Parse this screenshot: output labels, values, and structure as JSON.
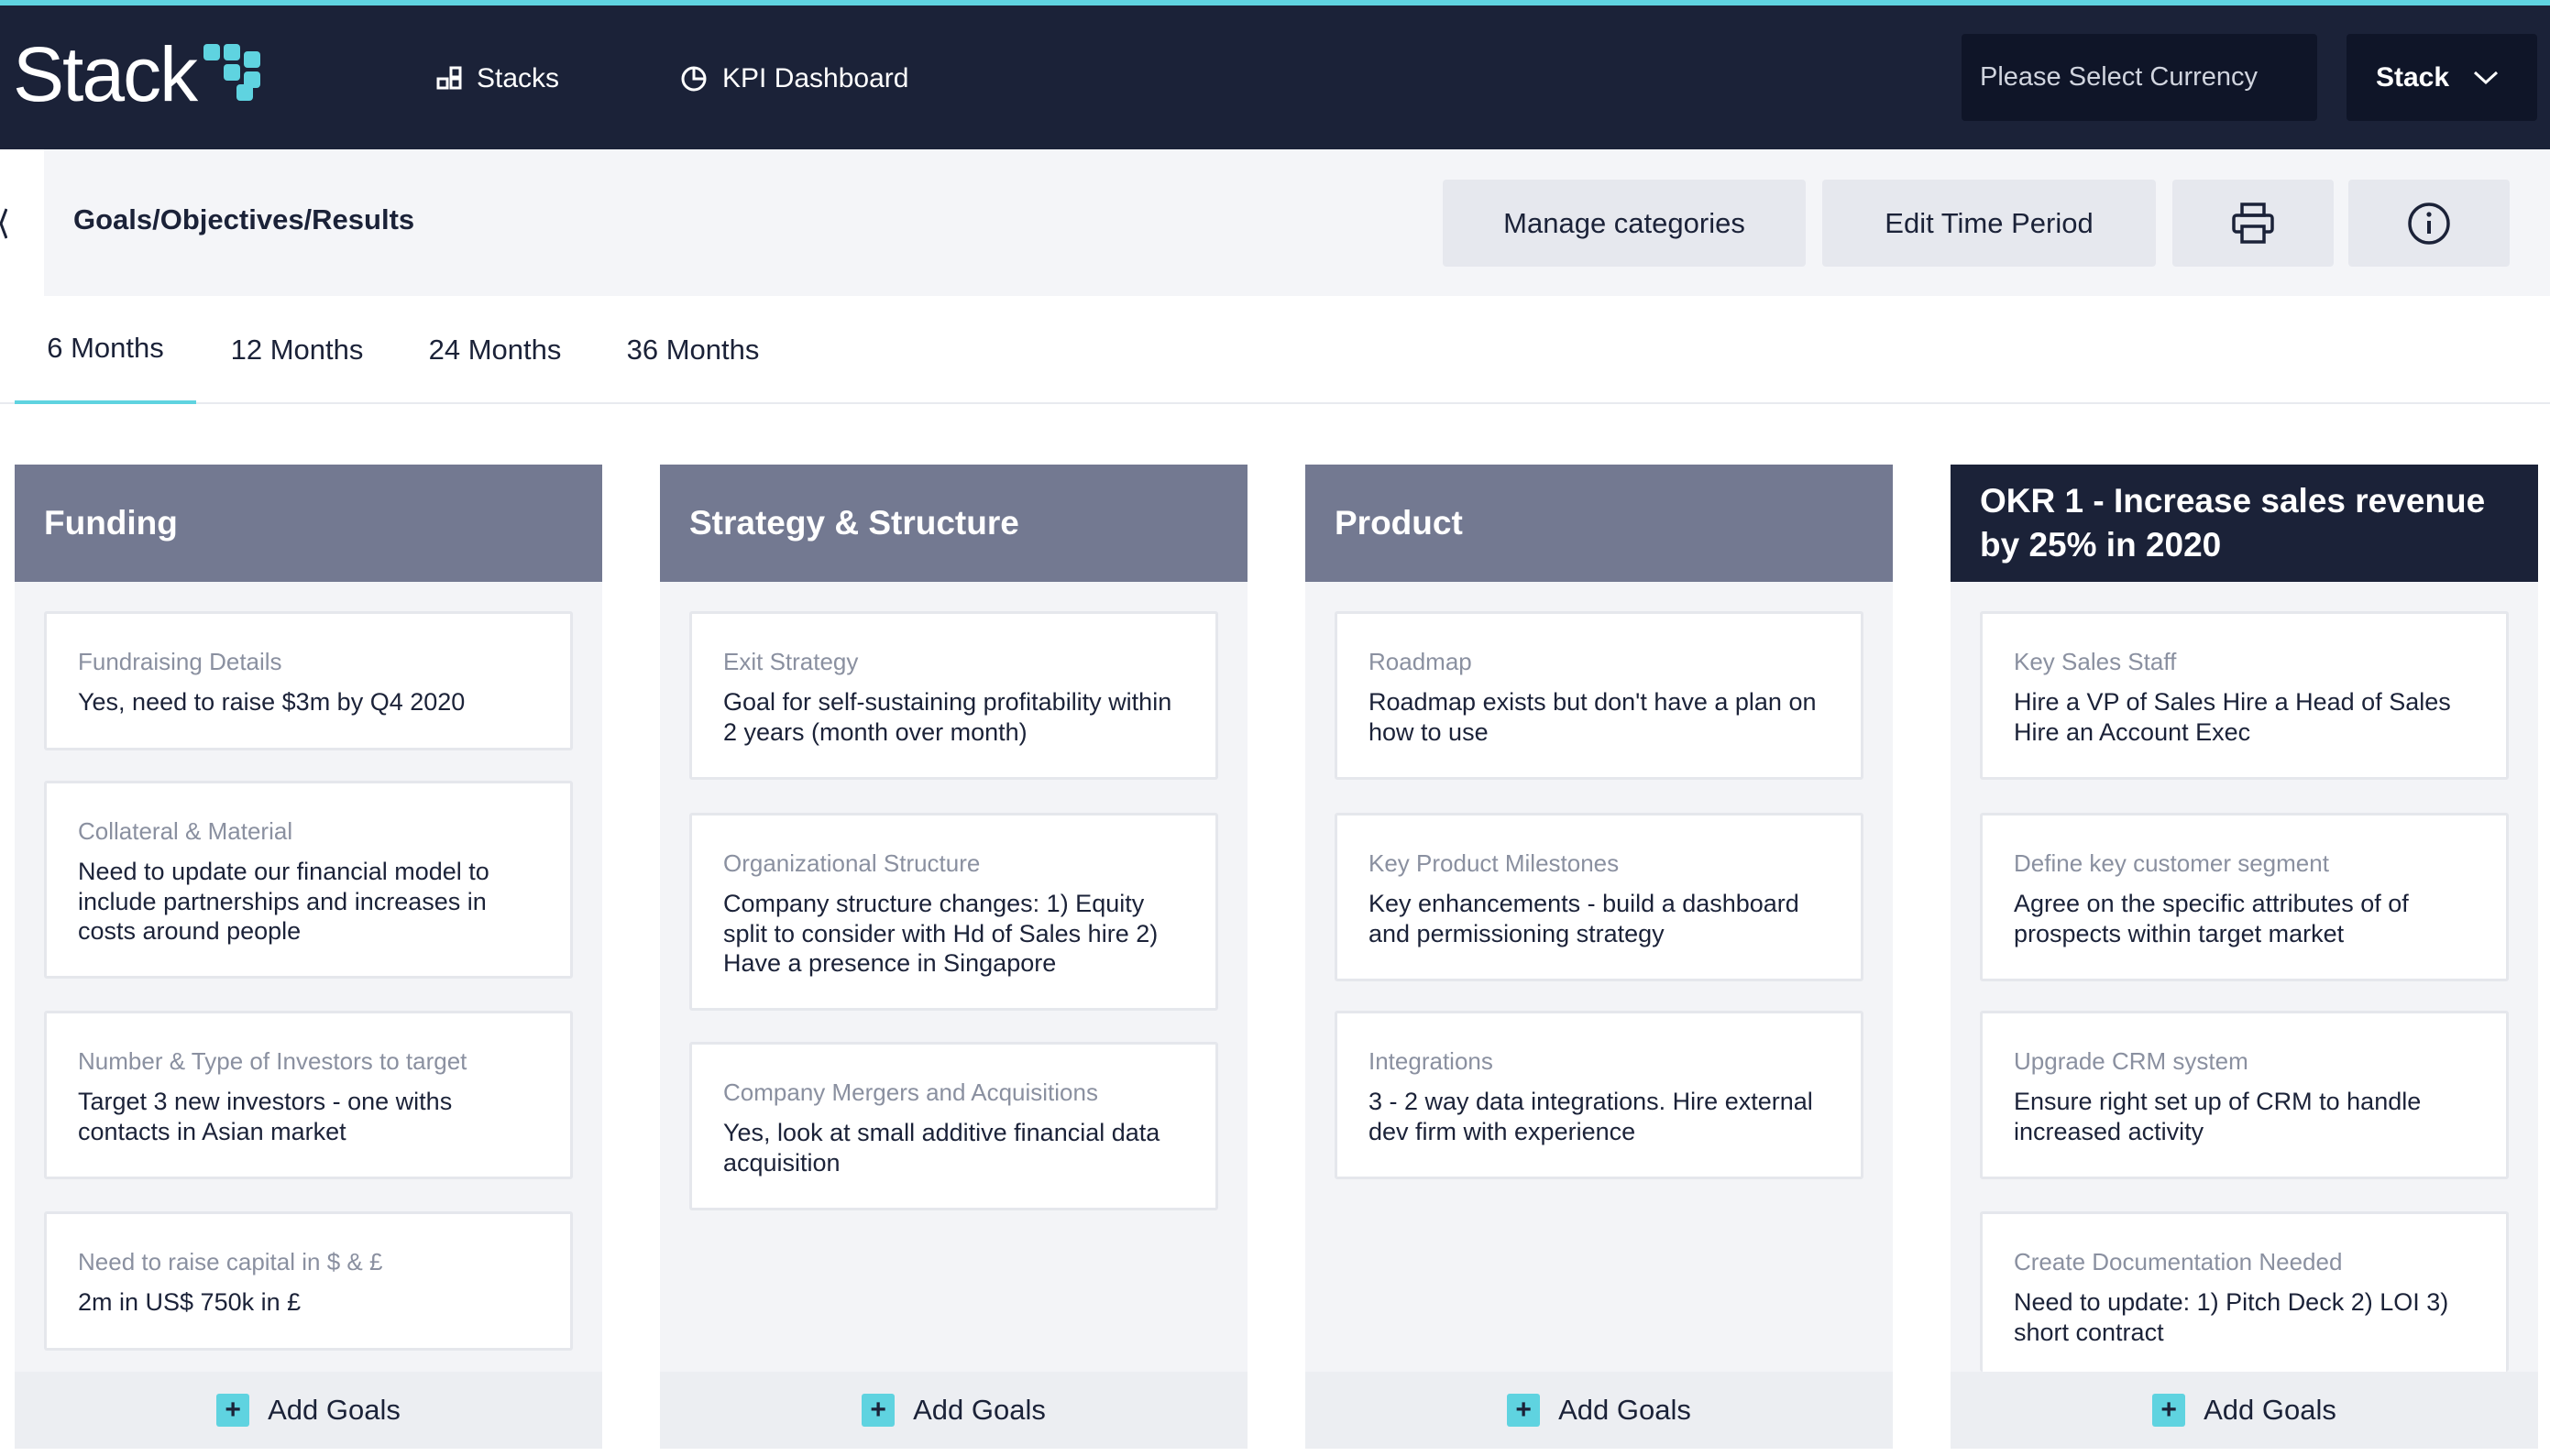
{
  "header": {
    "logo_text": "Stack",
    "nav": [
      {
        "label": "Stacks"
      },
      {
        "label": "KPI Dashboard"
      }
    ],
    "currency_placeholder": "Please Select Currency",
    "stack_select": "Stack"
  },
  "subbar": {
    "title": "Goals/Objectives/Results",
    "manage_categories": "Manage categories",
    "edit_time_period": "Edit Time Period"
  },
  "tabs": [
    {
      "label": "6 Months",
      "active": true
    },
    {
      "label": "12 Months",
      "active": false
    },
    {
      "label": "24 Months",
      "active": false
    },
    {
      "label": "36 Months",
      "active": false
    }
  ],
  "add_goals_label": "Add Goals",
  "columns": [
    {
      "title": "Funding",
      "cards": [
        {
          "label": "Fundraising Details",
          "value": "Yes, need to raise $3m by Q4 2020"
        },
        {
          "label": "Collateral & Material",
          "value": "Need to update our financial model to include partnerships and increases in costs around people"
        },
        {
          "label": "Number & Type of Investors to target",
          "value": "Target 3 new investors - one withs contacts in Asian market"
        },
        {
          "label": "Need to raise capital in $ & £",
          "value": "2m in US$ 750k in £"
        }
      ]
    },
    {
      "title": "Strategy & Structure",
      "cards": [
        {
          "label": "Exit Strategy",
          "value": "Goal for self-sustaining profitability within 2 years (month over month)"
        },
        {
          "label": "Organizational Structure",
          "value": "Company structure changes: 1) Equity split to consider with Hd of Sales hire 2) Have a presence in Singapore"
        },
        {
          "label": "Company Mergers and Acquisitions",
          "value": "Yes, look at small additive financial data acquisition"
        }
      ]
    },
    {
      "title": "Product",
      "cards": [
        {
          "label": "Roadmap",
          "value": "Roadmap exists but don't have a plan on how to use"
        },
        {
          "label": "Key Product Milestones",
          "value": "Key enhancements - build a dashboard and permissioning strategy"
        },
        {
          "label": "Integrations",
          "value": "3 - 2 way data integrations. Hire external dev firm with experience"
        }
      ]
    },
    {
      "title": "OKR 1 - Increase sales revenue by 25% in 2020",
      "cards": [
        {
          "label": "Key Sales Staff",
          "value": "Hire a VP of Sales Hire a Head of Sales Hire an Account Exec"
        },
        {
          "label": "Define key customer segment",
          "value": "Agree on the specific attributes of of prospects within target market"
        },
        {
          "label": "Upgrade CRM system",
          "value": "Ensure right set up of CRM to handle increased activity"
        },
        {
          "label": "Create Documentation Needed",
          "value": "Need to update: 1) Pitch Deck 2) LOI 3) short contract"
        }
      ]
    }
  ]
}
